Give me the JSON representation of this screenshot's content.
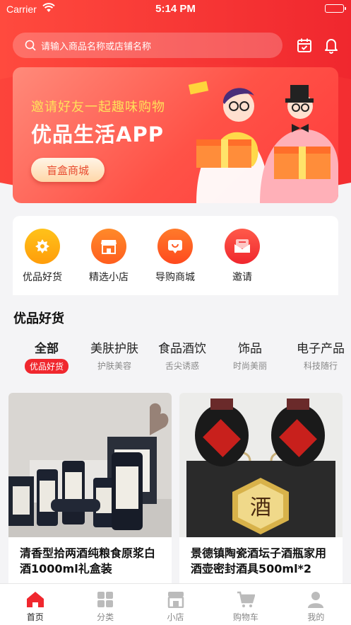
{
  "status_bar": {
    "carrier": "Carrier",
    "time": "5:14 PM"
  },
  "search": {
    "placeholder": "请输入商品名称或店铺名称"
  },
  "banner": {
    "subtitle": "邀请好友一起趣味购物",
    "title": "优品生活APP",
    "button": "盲盒商城"
  },
  "categories": [
    {
      "label": "优品好货",
      "icon": "star-badge-icon"
    },
    {
      "label": "精选小店",
      "icon": "store-icon"
    },
    {
      "label": "导购商城",
      "icon": "smile-bag-icon"
    },
    {
      "label": "邀请",
      "icon": "mail-icon"
    }
  ],
  "section_title": "优品好货",
  "product_tabs": [
    {
      "main": "全部",
      "sub": "优品好货"
    },
    {
      "main": "美肤护肤",
      "sub": "护肤美容"
    },
    {
      "main": "食品酒饮",
      "sub": "舌尖诱惑"
    },
    {
      "main": "饰品",
      "sub": "时尚美丽"
    },
    {
      "main": "电子产品",
      "sub": "科技随行"
    }
  ],
  "products": [
    {
      "title": "清香型拾两酒纯粮食原浆白酒1000ml礼盒装"
    },
    {
      "title": "景德镇陶瓷酒坛子酒瓶家用酒壶密封酒具500ml*2",
      "label_char": "酒"
    }
  ],
  "tabbar": [
    {
      "label": "首页",
      "icon": "home-icon"
    },
    {
      "label": "分类",
      "icon": "grid-icon"
    },
    {
      "label": "小店",
      "icon": "shop-icon"
    },
    {
      "label": "购物车",
      "icon": "cart-icon"
    },
    {
      "label": "我的",
      "icon": "user-icon"
    }
  ],
  "colors": {
    "brand_red": "#f0272e",
    "banner_yellow": "#ffe05a"
  }
}
